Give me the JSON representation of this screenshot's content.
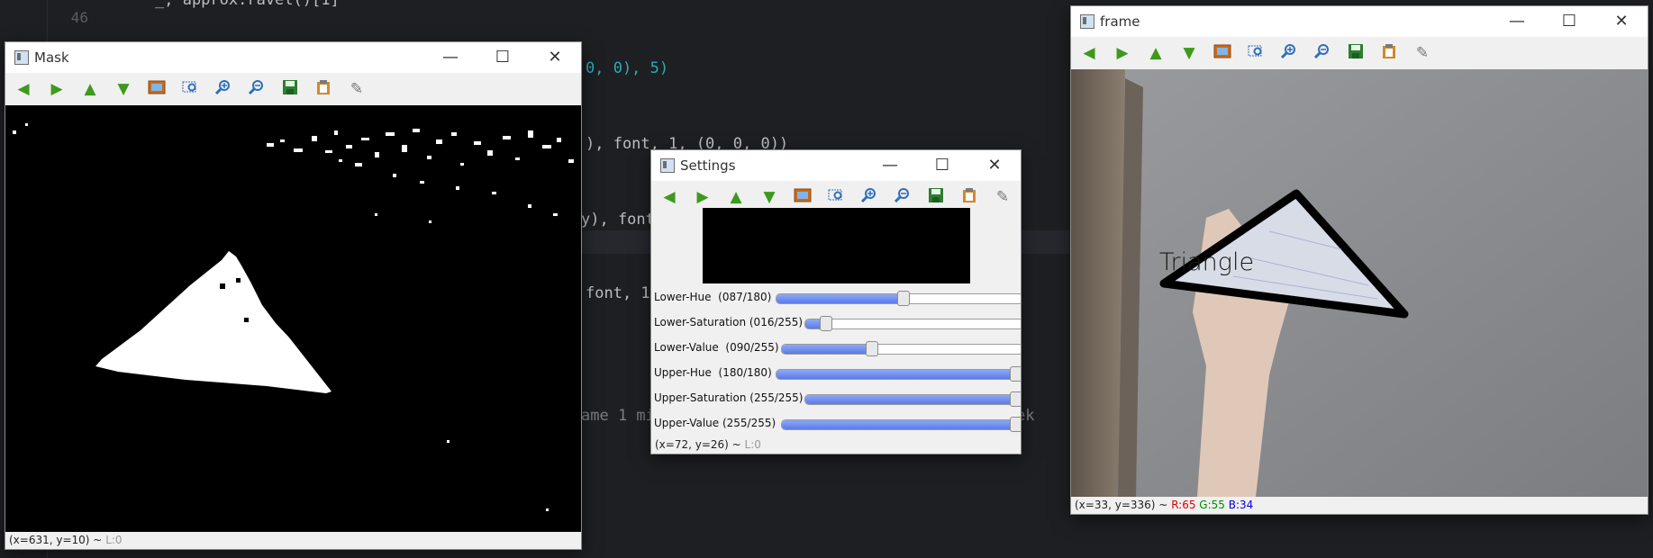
{
  "editor": {
    "line_numbers": [
      "46"
    ],
    "code_fragments": {
      "top": "_, approx.ravel()[1]",
      "color_end": "0, 0), 5)",
      "font_line": "), font, 1, (0, 0, 0))",
      "font2": "y), font",
      "font3": "font, 1",
      "comment": "ame 1 mi",
      "comment_tail": "ek"
    }
  },
  "windows": {
    "mask": {
      "title": "Mask",
      "status_coords": "(x=631, y=10) ~",
      "status_value": "L:0"
    },
    "settings": {
      "title": "Settings",
      "status_coords": "(x=72, y=26) ~",
      "status_value": "L:0",
      "trackbars": [
        {
          "label": "Lower-Hue  (087/180)",
          "value": 87,
          "max": 180
        },
        {
          "label": "Lower-Saturation (016/255)",
          "value": 16,
          "max": 255
        },
        {
          "label": "Lower-Value  (090/255)",
          "value": 90,
          "max": 255
        },
        {
          "label": "Upper-Hue  (180/180)",
          "value": 180,
          "max": 180
        },
        {
          "label": "Upper-Saturation (255/255)",
          "value": 255,
          "max": 255
        },
        {
          "label": "Upper-Value (255/255)",
          "value": 255,
          "max": 255
        }
      ]
    },
    "frame": {
      "title": "frame",
      "overlay_text": "Triangle",
      "status_coords": "(x=33, y=336) ~",
      "status_r": "R:65",
      "status_g": "G:55",
      "status_b": "B:34"
    }
  },
  "window_controls": {
    "minimize": "—",
    "maximize": "☐",
    "close": "✕"
  },
  "toolbar_icons": [
    "arrow-left-icon",
    "arrow-right-icon",
    "arrow-up-icon",
    "arrow-down-icon",
    "image-icon",
    "zoom-fit-icon",
    "zoom-in-icon",
    "zoom-out-icon",
    "save-icon",
    "copy-icon",
    "brush-icon"
  ],
  "colors": {
    "editor_bg": "#1e1f22",
    "number": "#2aacb8",
    "slider_fill": "#5b7be8",
    "status_r": "#e00000",
    "status_g": "#008a00",
    "status_b": "#0000e0"
  }
}
